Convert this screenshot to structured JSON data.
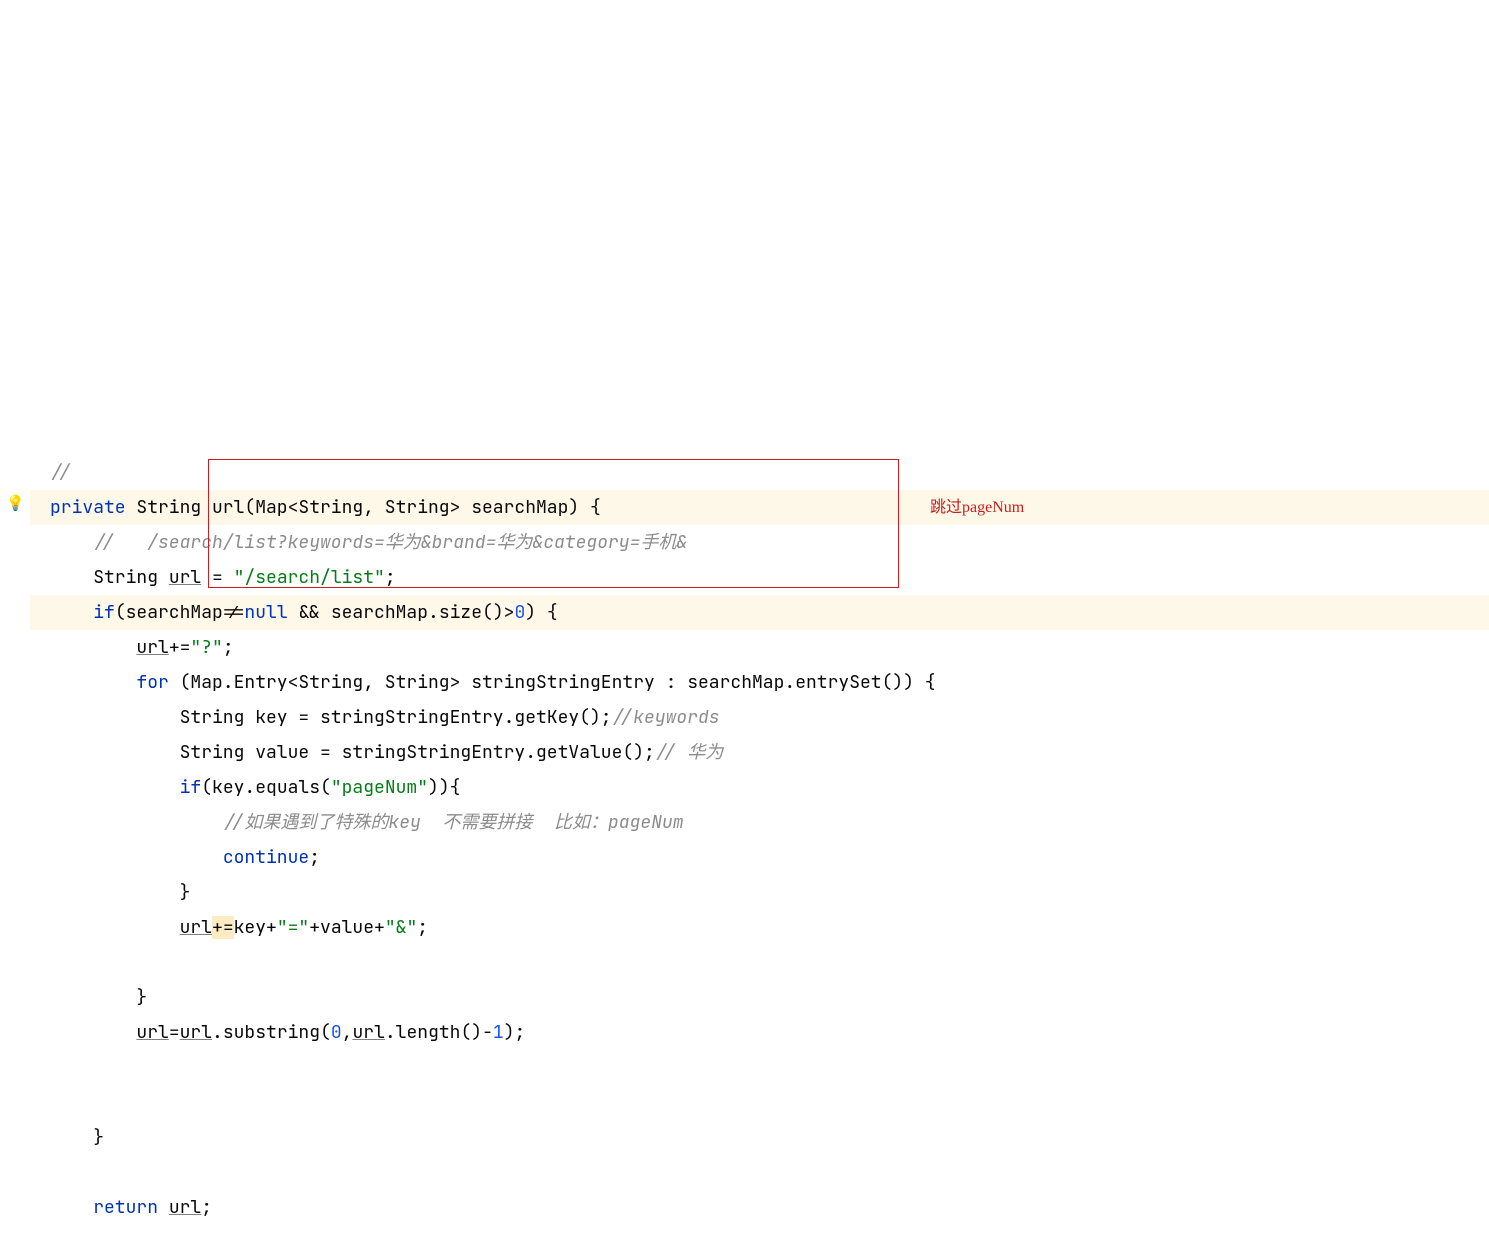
{
  "annotation": "跳过pageNum",
  "code": {
    "l01_cmt": "//",
    "l02_kw1": "private",
    "l02_t1": " String url(Map<String, String> searchMap) {",
    "l03_cmt": "//   /search/list?keywords=华为&brand=华为&category=手机&",
    "l04_a": "String ",
    "l04_url": "url",
    "l04_b": " = ",
    "l04_str": "\"/search/list\"",
    "l04_c": ";",
    "l05_kw": "if",
    "l05_a": "(searchMap!=",
    "l05_null": "null",
    "l05_b": " && searchMap.size()>",
    "l05_num": "0",
    "l05_c": ") {",
    "l06_url": "url",
    "l06_a": "+=",
    "l06_str": "\"?\"",
    "l06_b": ";",
    "l07_kw": "for",
    "l07_a": " (Map.Entry<String, String> stringStringEntry : searchMap.entrySet()) {",
    "l08_a": "String key = stringStringEntry.getKey();",
    "l08_cmt": "//keywords",
    "l09_a": "String value = stringStringEntry.getValue();",
    "l09_cmt": "// 华为",
    "l10_kw": "if",
    "l10_a": "(key.equals(",
    "l10_str": "\"pageNum\"",
    "l10_b": ")){",
    "l11_cmt": "//如果遇到了特殊的key  不需要拼接  比如：pageNum",
    "l12_kw": "continue",
    "l12_a": ";",
    "l13_a": "}",
    "l14_url": "url",
    "l14_mark": "+=",
    "l14_a": "key+",
    "l14_str1": "\"=\"",
    "l14_b": "+value+",
    "l14_str2": "\"&\"",
    "l14_c": ";",
    "l16_a": "}",
    "l17_url1": "url",
    "l17_a": "=",
    "l17_url2": "url",
    "l17_b": ".substring(",
    "l17_n1": "0",
    "l17_c": ",",
    "l17_url3": "url",
    "l17_d": ".length()-",
    "l17_n2": "1",
    "l17_e": ");",
    "l20_a": "}",
    "l22_kw": "return",
    "l22_a": " ",
    "l22_url": "url",
    "l22_b": ";"
  }
}
